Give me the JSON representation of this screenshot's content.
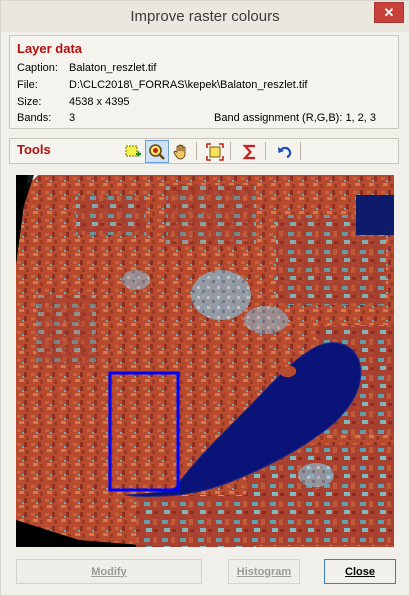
{
  "window": {
    "title": "Improve raster colours",
    "close_glyph": "✕"
  },
  "layer_data": {
    "heading": "Layer data",
    "caption_label": "Caption:",
    "caption_value": "Balaton_reszlet.tif",
    "file_label": "File:",
    "file_value": "D:\\CLC2018\\_FORRAS\\kepek\\Balaton_reszlet.tif",
    "size_label": "Size:",
    "size_value": "4538 x 4395",
    "bands_label": "Bands:",
    "bands_value": "3",
    "band_assignment": "Band assignment (R,G,B):  1, 2, 3"
  },
  "tools": {
    "heading": "Tools",
    "items": [
      {
        "name": "select-rectangle-icon",
        "active": false
      },
      {
        "name": "zoom-icon",
        "active": true
      },
      {
        "name": "pan-hand-icon",
        "active": false
      },
      {
        "name": "zoom-extent-icon",
        "active": false
      },
      {
        "name": "sigma-icon",
        "active": false
      },
      {
        "name": "undo-icon",
        "active": false
      }
    ]
  },
  "buttons": {
    "modify": "Modify",
    "histogram": "Histogram",
    "close": "Close"
  },
  "colors": {
    "heading_red": "#b30f0f",
    "lake_blue": "#0a1478",
    "selection_blue": "#0000ff",
    "vegetation_red": "#b5402a"
  }
}
